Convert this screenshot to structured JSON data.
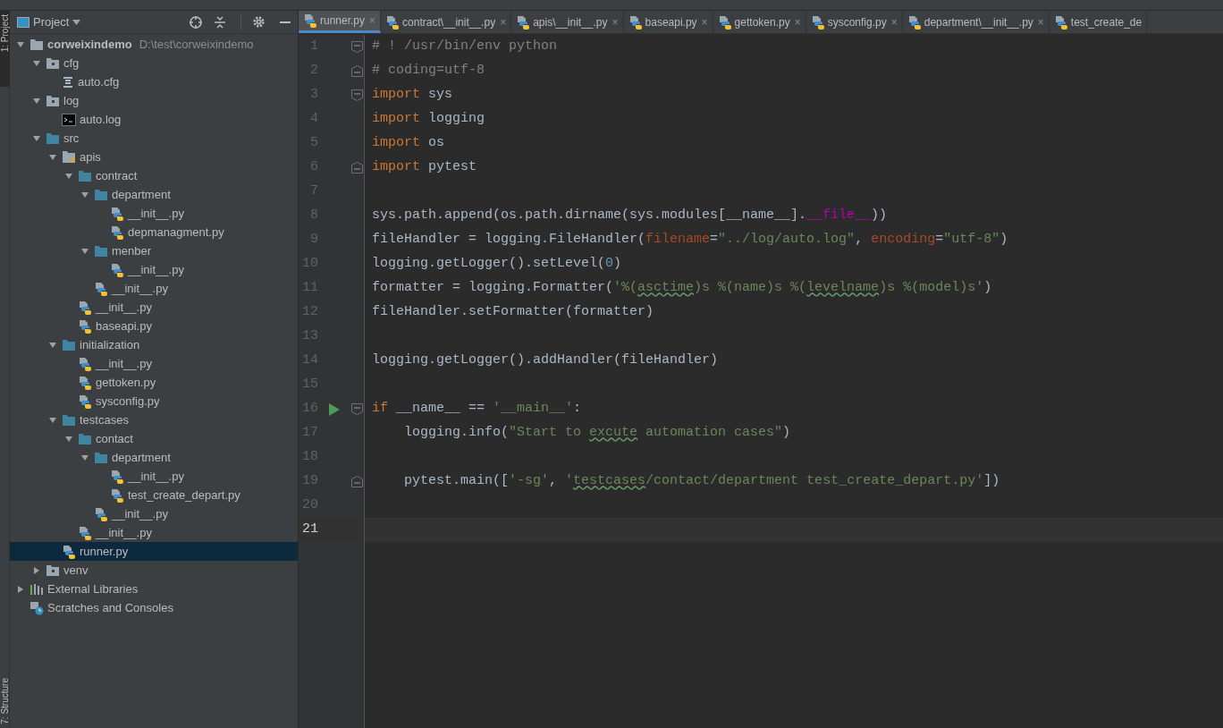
{
  "side_strip": {
    "top_tab": "1: Project",
    "bottom_tab": "7: Structure"
  },
  "project_panel": {
    "title": "Project",
    "tree": [
      {
        "name": "corweixindemo",
        "path": "D:\\test\\corweixindemo",
        "kind": "folder-grey",
        "expanded": true,
        "selected": false,
        "children": [
          {
            "name": "cfg",
            "kind": "folder-dot",
            "expanded": true,
            "selected": false,
            "children": [
              {
                "name": "auto.cfg",
                "kind": "config",
                "selected": false
              }
            ]
          },
          {
            "name": "log",
            "kind": "folder-dot",
            "expanded": true,
            "selected": false,
            "children": [
              {
                "name": "auto.log",
                "kind": "terminal",
                "selected": false
              }
            ]
          },
          {
            "name": "src",
            "kind": "folder",
            "expanded": true,
            "selected": false,
            "children": [
              {
                "name": "apis",
                "kind": "package",
                "expanded": true,
                "selected": false,
                "children": [
                  {
                    "name": "contract",
                    "kind": "folder",
                    "expanded": true,
                    "selected": false,
                    "children": [
                      {
                        "name": "department",
                        "kind": "folder",
                        "expanded": true,
                        "selected": false,
                        "children": [
                          {
                            "name": "__init__.py",
                            "kind": "python",
                            "selected": false
                          },
                          {
                            "name": "depmanagment.py",
                            "kind": "python",
                            "selected": false
                          }
                        ]
                      },
                      {
                        "name": "menber",
                        "kind": "folder",
                        "expanded": true,
                        "selected": false,
                        "children": [
                          {
                            "name": "__init__.py",
                            "kind": "python",
                            "selected": false
                          }
                        ]
                      },
                      {
                        "name": "__init__.py",
                        "kind": "python",
                        "selected": false
                      }
                    ]
                  },
                  {
                    "name": "__init__.py",
                    "kind": "python",
                    "selected": false
                  },
                  {
                    "name": "baseapi.py",
                    "kind": "python",
                    "selected": false
                  }
                ]
              },
              {
                "name": "initialization",
                "kind": "folder",
                "expanded": true,
                "selected": false,
                "children": [
                  {
                    "name": "__init__.py",
                    "kind": "python",
                    "selected": false
                  },
                  {
                    "name": "gettoken.py",
                    "kind": "python",
                    "selected": false
                  },
                  {
                    "name": "sysconfig.py",
                    "kind": "python",
                    "selected": false
                  }
                ]
              },
              {
                "name": "testcases",
                "kind": "folder",
                "expanded": true,
                "selected": false,
                "children": [
                  {
                    "name": "contact",
                    "kind": "folder",
                    "expanded": true,
                    "selected": false,
                    "children": [
                      {
                        "name": "department",
                        "kind": "folder",
                        "expanded": true,
                        "selected": false,
                        "children": [
                          {
                            "name": "__init__.py",
                            "kind": "python",
                            "selected": false
                          },
                          {
                            "name": "test_create_depart.py",
                            "kind": "python",
                            "selected": false
                          }
                        ]
                      },
                      {
                        "name": "__init__.py",
                        "kind": "python",
                        "selected": false
                      }
                    ]
                  },
                  {
                    "name": "__init__.py",
                    "kind": "python",
                    "selected": false
                  }
                ]
              },
              {
                "name": "runner.py",
                "kind": "python",
                "selected": true
              }
            ]
          },
          {
            "name": "venv",
            "kind": "folder-dot",
            "expanded": false,
            "selected": false
          }
        ]
      },
      {
        "name": "External Libraries",
        "kind": "libraries",
        "expanded": false,
        "selected": false
      },
      {
        "name": "Scratches and Consoles",
        "kind": "scratches",
        "selected": false
      }
    ]
  },
  "editor_tabs": [
    {
      "label": "runner.py",
      "selected": true,
      "close": "×"
    },
    {
      "label": "contract\\__init__.py",
      "selected": false,
      "close": "×"
    },
    {
      "label": "apis\\__init__.py",
      "selected": false,
      "close": "×"
    },
    {
      "label": "baseapi.py",
      "selected": false,
      "close": "×"
    },
    {
      "label": "gettoken.py",
      "selected": false,
      "close": "×"
    },
    {
      "label": "sysconfig.py",
      "selected": false,
      "close": "×"
    },
    {
      "label": "department\\__init__.py",
      "selected": false,
      "close": "×"
    },
    {
      "label": "test_create_de",
      "selected": false
    }
  ],
  "code_lines": [
    {
      "number": "1",
      "fold_open": true,
      "fold_close": false,
      "run": false,
      "current": false,
      "tokens": [
        {
          "kind": "comment",
          "text": "# ! /usr/bin/env python"
        }
      ]
    },
    {
      "number": "2",
      "fold_open": false,
      "fold_close": true,
      "run": false,
      "current": false,
      "tokens": [
        {
          "kind": "comment",
          "text": "# coding=utf-8"
        }
      ]
    },
    {
      "number": "3",
      "fold_open": true,
      "fold_close": false,
      "run": false,
      "current": false,
      "tokens": [
        {
          "kind": "keyword",
          "text": "import"
        },
        {
          "kind": "plain",
          "text": " sys"
        }
      ]
    },
    {
      "number": "4",
      "fold_open": false,
      "fold_close": false,
      "run": false,
      "current": false,
      "tokens": [
        {
          "kind": "keyword",
          "text": "import"
        },
        {
          "kind": "plain",
          "text": " logging"
        }
      ]
    },
    {
      "number": "5",
      "fold_open": false,
      "fold_close": false,
      "run": false,
      "current": false,
      "tokens": [
        {
          "kind": "keyword",
          "text": "import"
        },
        {
          "kind": "plain",
          "text": " os"
        }
      ]
    },
    {
      "number": "6",
      "fold_open": false,
      "fold_close": true,
      "run": false,
      "current": false,
      "tokens": [
        {
          "kind": "keyword",
          "text": "import"
        },
        {
          "kind": "plain",
          "text": " pytest"
        }
      ]
    },
    {
      "number": "7",
      "fold_open": false,
      "fold_close": false,
      "run": false,
      "current": false
    },
    {
      "number": "8",
      "fold_open": false,
      "fold_close": false,
      "run": false,
      "current": false,
      "tokens": [
        {
          "kind": "plain",
          "text": "sys.path.append(os.path.dirname(sys.modules[__name__]."
        },
        {
          "kind": "magic",
          "text": "__file__"
        },
        {
          "kind": "plain",
          "text": "))"
        }
      ]
    },
    {
      "number": "9",
      "fold_open": false,
      "fold_close": false,
      "run": false,
      "current": false,
      "tokens": [
        {
          "kind": "plain",
          "text": "fileHandler = logging.FileHandler("
        },
        {
          "kind": "param",
          "text": "filename"
        },
        {
          "kind": "plain",
          "text": "="
        },
        {
          "kind": "string",
          "text": "\"../log/auto.log\""
        },
        {
          "kind": "plain",
          "text": ", "
        },
        {
          "kind": "param",
          "text": "encoding"
        },
        {
          "kind": "plain",
          "text": "="
        },
        {
          "kind": "string",
          "text": "\"utf-8\""
        },
        {
          "kind": "plain",
          "text": ")"
        }
      ]
    },
    {
      "number": "10",
      "fold_open": false,
      "fold_close": false,
      "run": false,
      "current": false,
      "tokens": [
        {
          "kind": "plain",
          "text": "logging.getLogger().setLevel("
        },
        {
          "kind": "number",
          "text": "0"
        },
        {
          "kind": "plain",
          "text": ")"
        }
      ]
    },
    {
      "number": "11",
      "fold_open": false,
      "fold_close": false,
      "run": false,
      "current": false,
      "tokens": [
        {
          "kind": "plain",
          "text": "formatter = logging.Formatter("
        },
        {
          "kind": "string",
          "text": "'%("
        },
        {
          "kind": "string-typo",
          "text": "asctime"
        },
        {
          "kind": "string",
          "text": ")s %(name)s %("
        },
        {
          "kind": "string-typo",
          "text": "levelname"
        },
        {
          "kind": "string",
          "text": ")s %(model)s'"
        },
        {
          "kind": "plain",
          "text": ")"
        }
      ]
    },
    {
      "number": "12",
      "fold_open": false,
      "fold_close": false,
      "run": false,
      "current": false,
      "tokens": [
        {
          "kind": "plain",
          "text": "fileHandler.setFormatter(formatter)"
        }
      ]
    },
    {
      "number": "13",
      "fold_open": false,
      "fold_close": false,
      "run": false,
      "current": false
    },
    {
      "number": "14",
      "fold_open": false,
      "fold_close": false,
      "run": false,
      "current": false,
      "tokens": [
        {
          "kind": "plain",
          "text": "logging.getLogger().addHandler(fileHandler)"
        }
      ]
    },
    {
      "number": "15",
      "fold_open": false,
      "fold_close": false,
      "run": false,
      "current": false
    },
    {
      "number": "16",
      "fold_open": true,
      "fold_close": false,
      "run": true,
      "current": false,
      "tokens": [
        {
          "kind": "keyword",
          "text": "if"
        },
        {
          "kind": "plain",
          "text": " __name__ == "
        },
        {
          "kind": "string",
          "text": "'__main__'"
        },
        {
          "kind": "plain",
          "text": ":"
        }
      ]
    },
    {
      "number": "17",
      "fold_open": false,
      "fold_close": false,
      "run": false,
      "current": false,
      "tokens": [
        {
          "kind": "plain",
          "text": "    logging.info("
        },
        {
          "kind": "string",
          "text": "\"Start to "
        },
        {
          "kind": "string-typo",
          "text": "excute"
        },
        {
          "kind": "string",
          "text": " automation cases\""
        },
        {
          "kind": "plain",
          "text": ")"
        }
      ]
    },
    {
      "number": "18",
      "fold_open": false,
      "fold_close": false,
      "run": false,
      "current": false
    },
    {
      "number": "19",
      "fold_open": false,
      "fold_close": true,
      "run": false,
      "current": false,
      "tokens": [
        {
          "kind": "plain",
          "text": "    pytest.main(["
        },
        {
          "kind": "string",
          "text": "'-sg'"
        },
        {
          "kind": "plain",
          "text": ", "
        },
        {
          "kind": "string",
          "text": "'"
        },
        {
          "kind": "string-typo",
          "text": "testcases"
        },
        {
          "kind": "string",
          "text": "/contact/department test_create_depart.py'"
        },
        {
          "kind": "plain",
          "text": "])"
        }
      ]
    },
    {
      "number": "20",
      "fold_open": false,
      "fold_close": false,
      "run": false,
      "current": false
    },
    {
      "number": "21",
      "fold_open": false,
      "fold_close": false,
      "run": false,
      "current": true
    }
  ]
}
